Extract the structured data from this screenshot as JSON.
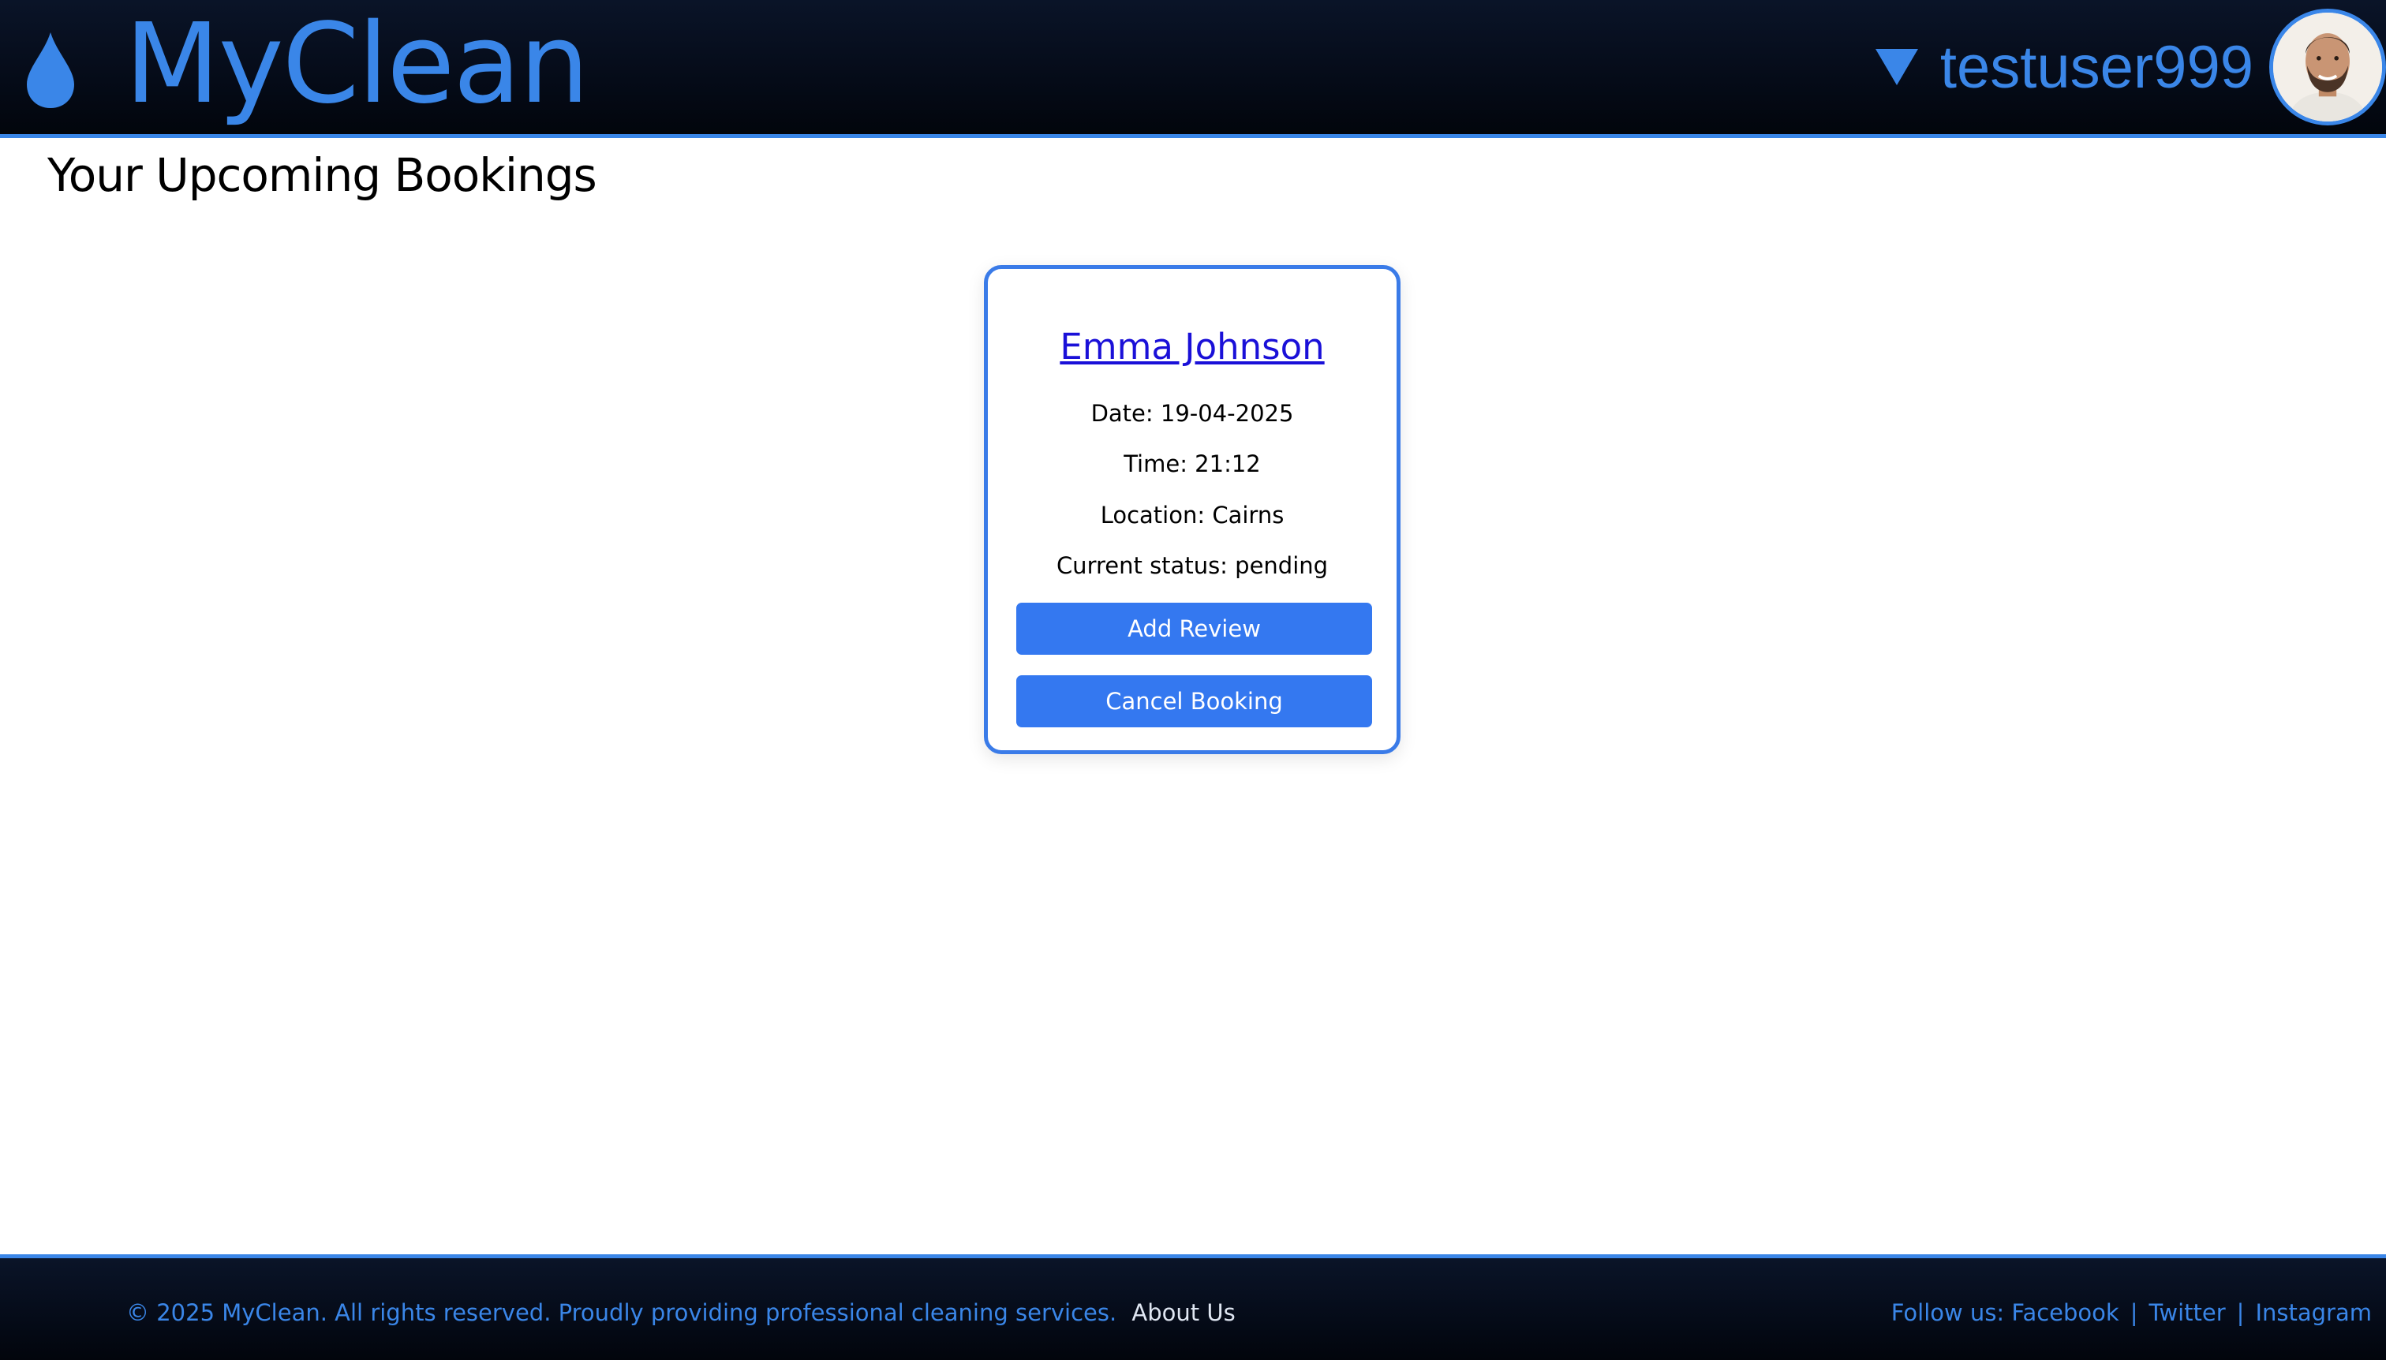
{
  "header": {
    "brand": "MyClean",
    "username": "testuser999"
  },
  "page": {
    "title": "Your Upcoming Bookings"
  },
  "booking": {
    "cleaner_name": "Emma Johnson",
    "date_line": "Date: 19-04-2025",
    "time_line": "Time: 21:12",
    "location_line": "Location: Cairns",
    "status_line": "Current status: pending",
    "add_review_label": "Add Review",
    "cancel_label": "Cancel Booking"
  },
  "footer": {
    "copyright": "© 2025 MyClean. All rights reserved. Proudly providing professional cleaning services.",
    "about_label": "About Us",
    "follow_label": "Follow us:",
    "facebook_label": "Facebook",
    "twitter_label": "Twitter",
    "instagram_label": "Instagram",
    "separator": "|"
  },
  "icons": {
    "logo": "water-drop-icon",
    "menu": "caret-down-icon"
  },
  "colors": {
    "accent": "#3a86e8",
    "button": "#3478f0",
    "link": "#1a10d8",
    "header_bg": "#050b18"
  }
}
